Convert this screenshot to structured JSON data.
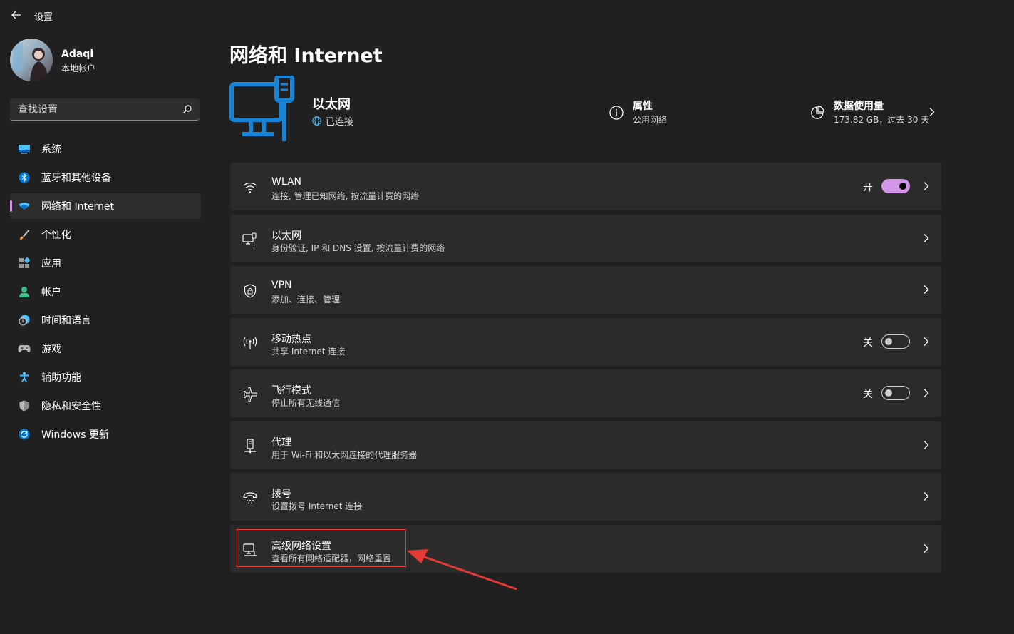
{
  "app": {
    "title": "设置"
  },
  "user": {
    "name": "Adaqi",
    "account_type": "本地帐户"
  },
  "search": {
    "placeholder": "查找设置"
  },
  "sidebar": {
    "items": [
      {
        "label": "系统",
        "icon": "system-icon",
        "active": false
      },
      {
        "label": "蓝牙和其他设备",
        "icon": "bluetooth-icon",
        "active": false
      },
      {
        "label": "网络和 Internet",
        "icon": "network-icon",
        "active": true
      },
      {
        "label": "个性化",
        "icon": "brush-icon",
        "active": false
      },
      {
        "label": "应用",
        "icon": "apps-icon",
        "active": false
      },
      {
        "label": "帐户",
        "icon": "account-icon",
        "active": false
      },
      {
        "label": "时间和语言",
        "icon": "clock-globe-icon",
        "active": false
      },
      {
        "label": "游戏",
        "icon": "gamepad-icon",
        "active": false
      },
      {
        "label": "辅助功能",
        "icon": "accessibility-icon",
        "active": false
      },
      {
        "label": "隐私和安全性",
        "icon": "shield-icon",
        "active": false
      },
      {
        "label": "Windows 更新",
        "icon": "update-icon",
        "active": false
      }
    ]
  },
  "page": {
    "title": "网络和 Internet",
    "hero": {
      "name": "以太网",
      "status": "已连接",
      "properties": {
        "title": "属性",
        "subtitle": "公用网络"
      },
      "data_usage": {
        "title": "数据使用量",
        "subtitle": "173.82 GB，过去 30 天"
      }
    },
    "rows": [
      {
        "title": "WLAN",
        "subtitle": "连接, 管理已知网络, 按流量计费的网络",
        "toggle": "开",
        "toggle_on": true,
        "icon": "wifi-icon"
      },
      {
        "title": "以太网",
        "subtitle": "身份验证, IP 和 DNS 设置, 按流量计费的网络",
        "icon": "ethernet-icon"
      },
      {
        "title": "VPN",
        "subtitle": "添加、连接、管理",
        "icon": "vpn-shield-icon"
      },
      {
        "title": "移动热点",
        "subtitle": "共享 Internet 连接",
        "toggle": "关",
        "toggle_on": false,
        "icon": "hotspot-icon"
      },
      {
        "title": "飞行模式",
        "subtitle": "停止所有无线通信",
        "toggle": "关",
        "toggle_on": false,
        "icon": "airplane-icon"
      },
      {
        "title": "代理",
        "subtitle": "用于 Wi-Fi 和以太网连接的代理服务器",
        "icon": "proxy-icon"
      },
      {
        "title": "拨号",
        "subtitle": "设置拨号 Internet 连接",
        "icon": "dialup-icon"
      },
      {
        "title": "高级网络设置",
        "subtitle": "查看所有网络适配器，网络重置",
        "icon": "advanced-network-icon"
      }
    ]
  },
  "colors": {
    "accent": "#d296e6",
    "brand_blue": "#0078d4",
    "annotation_red": "#e53935",
    "background": "#202020",
    "card": "#2b2b2b"
  }
}
